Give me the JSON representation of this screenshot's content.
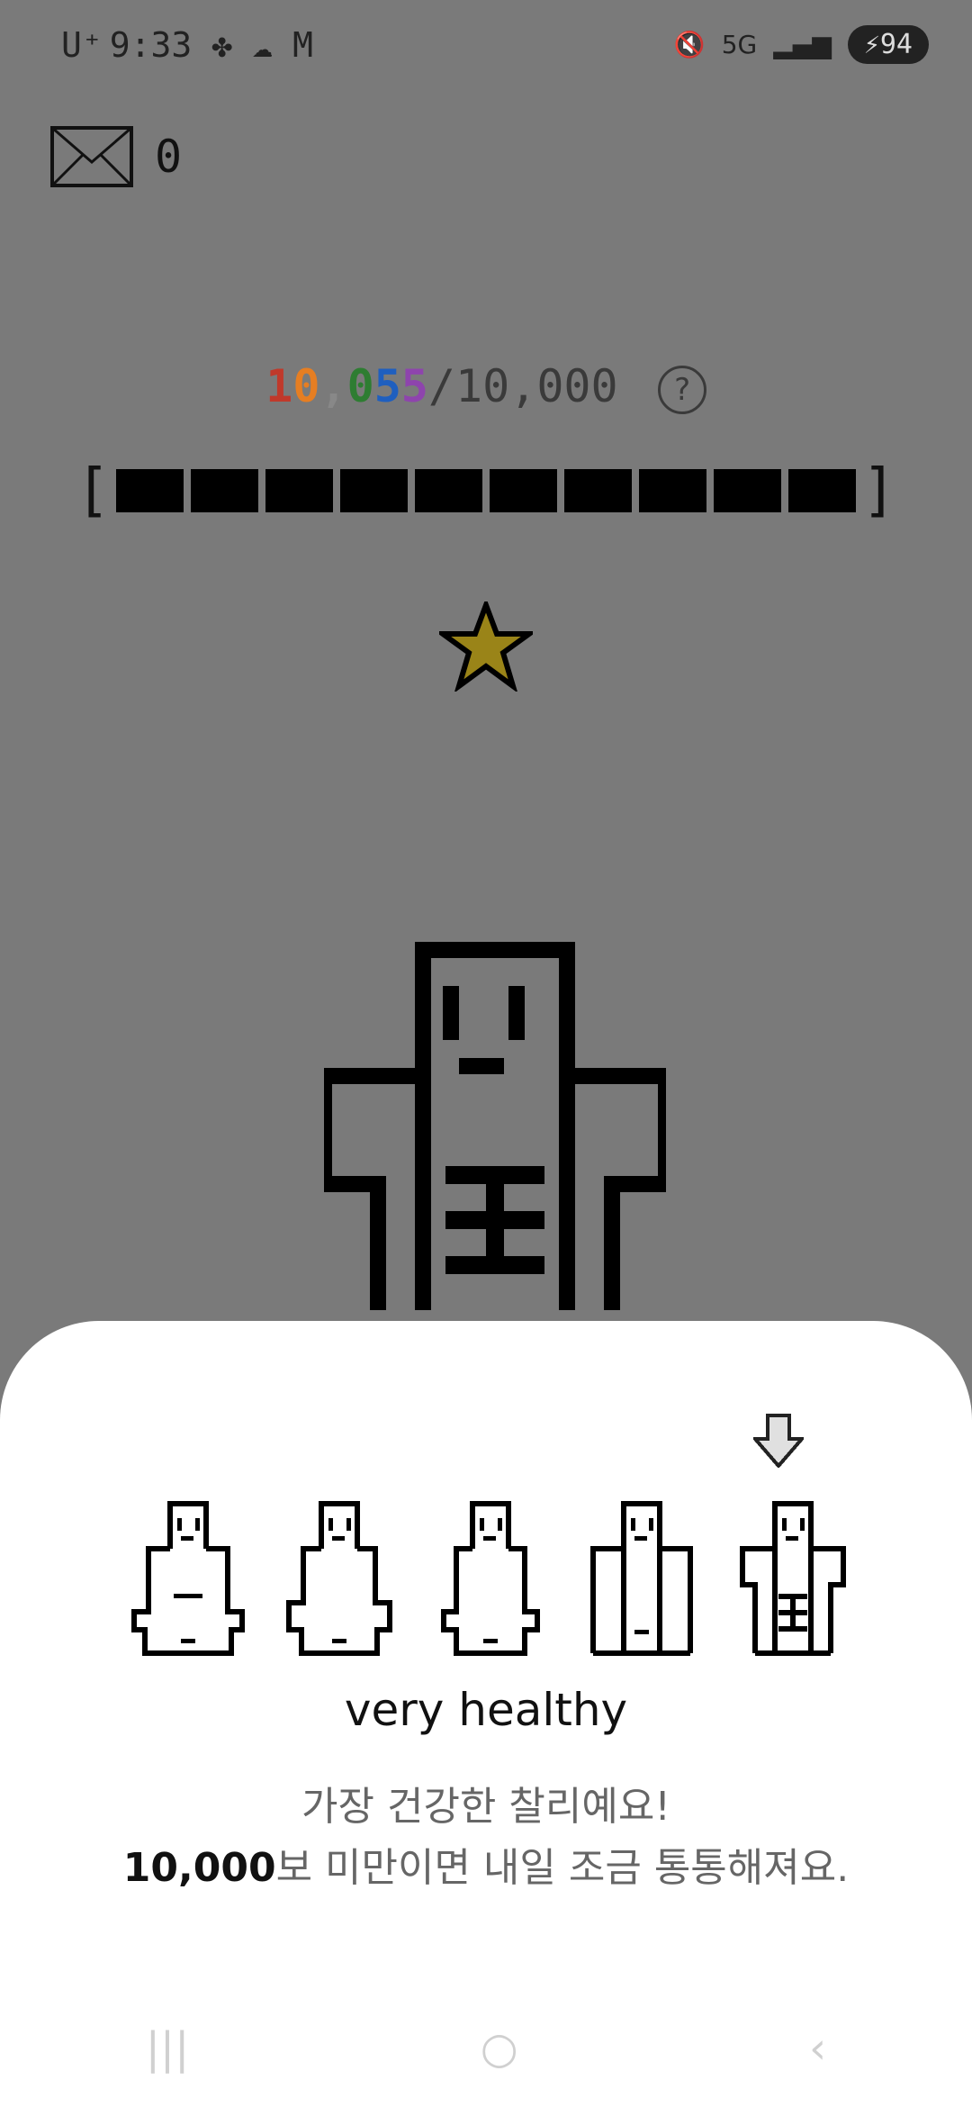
{
  "status_bar": {
    "carrier": "U⁺",
    "time": "9:33",
    "network": "5G",
    "battery": "94"
  },
  "mail": {
    "count": "0"
  },
  "steps": {
    "current_digits": [
      "1",
      "0",
      ",",
      "0",
      "5",
      "5"
    ],
    "digit_colors": [
      "#c0392b",
      "#e67e22",
      "#888888",
      "#2e7d32",
      "#1f5fbf",
      "#8e44ad"
    ],
    "goal": "/10,000",
    "help": "?"
  },
  "progress": {
    "filled_blocks": 10,
    "total_blocks": 10
  },
  "levels": {
    "current_index": 4,
    "count": 5
  },
  "sheet": {
    "title": "very healthy",
    "desc_line1": "가장 건강한 찰리예요!",
    "desc_line2_bold": "10,000",
    "desc_line2_rest": "보 미만이면 내일 조금 통통해져요."
  },
  "navbar": {
    "recent": "|||",
    "home": "○",
    "back": "‹"
  }
}
